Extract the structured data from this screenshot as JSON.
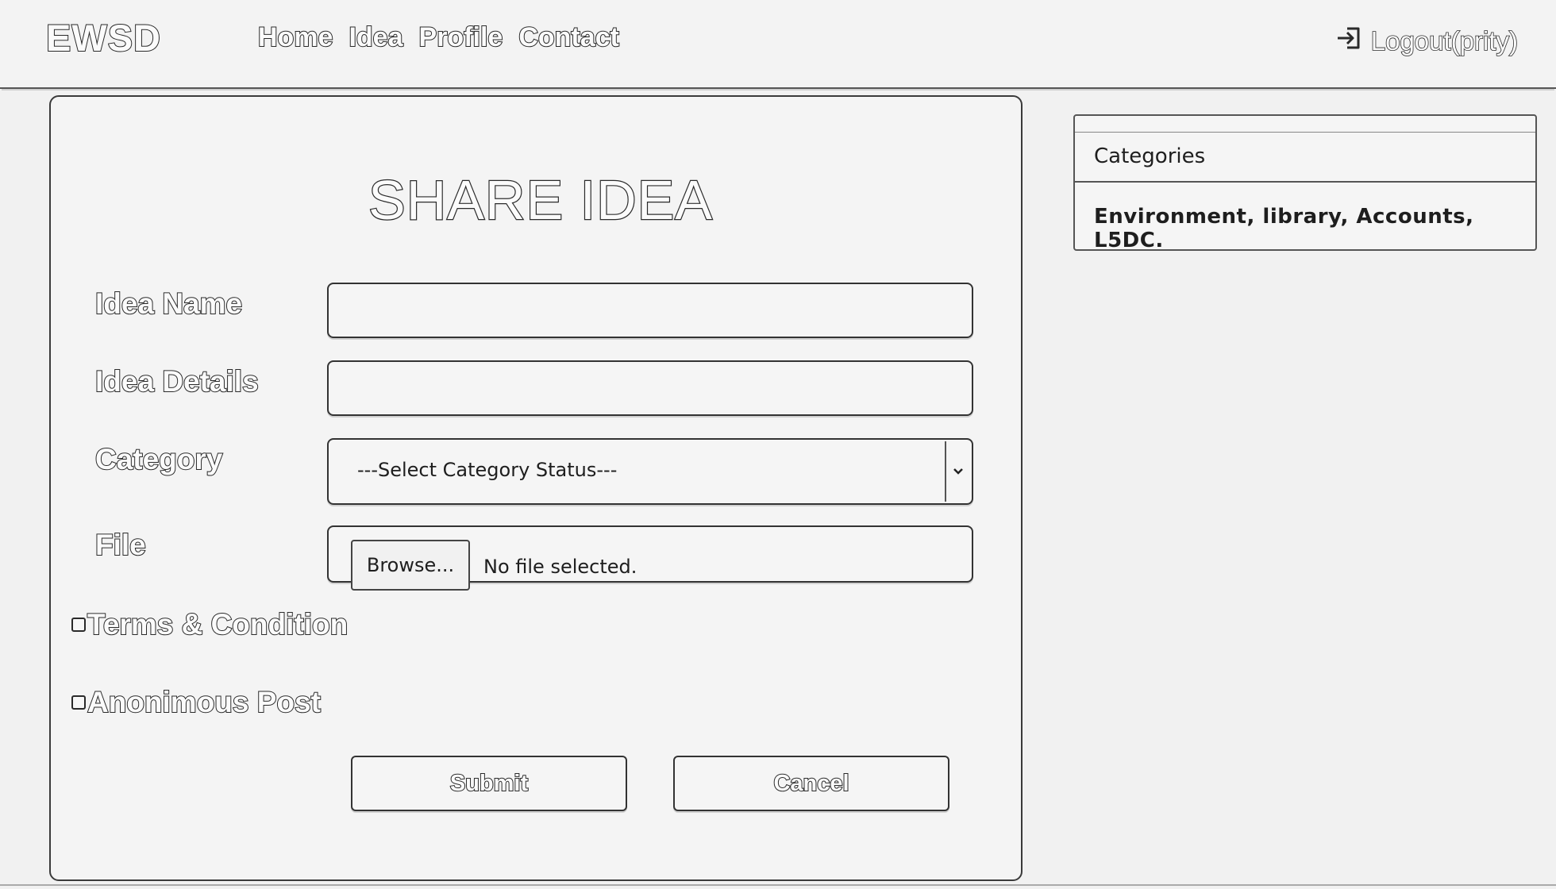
{
  "header": {
    "brand": "EWSD",
    "nav": [
      "Home",
      "Idea",
      "Profile",
      "Contact"
    ],
    "logout_label": "Logout(prity)"
  },
  "form": {
    "title": "SHARE IDEA",
    "idea_name_label": "Idea Name",
    "idea_name_value": "",
    "idea_details_label": "Idea Details",
    "idea_details_value": "",
    "category_label": "Category",
    "category_selected": "---Select Category Status---",
    "file_label": "File",
    "browse_label": "Browse...",
    "file_status": "No file selected.",
    "terms_label": "Terms & Condition",
    "terms_checked": false,
    "anon_label": "Anonimous Post",
    "anon_checked": false,
    "submit_label": "Submit",
    "cancel_label": "Cancel"
  },
  "sidebar": {
    "heading": "Categories",
    "body": "Environment, library, Accounts, L5DC."
  },
  "icons": {
    "logout": "logout-icon",
    "select": "chevron-down-icon"
  }
}
